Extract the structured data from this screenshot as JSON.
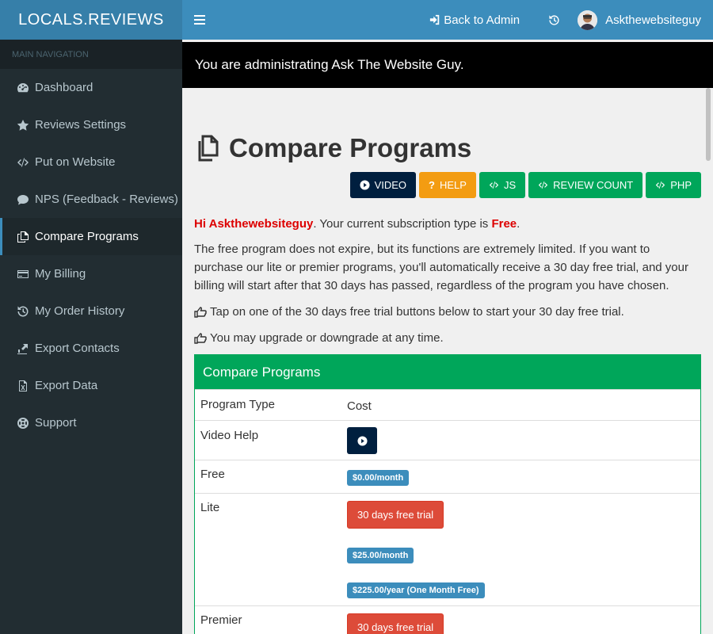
{
  "brand": {
    "logo": "LOCALS.REVIEWS",
    "accent": "#3c8dbc",
    "logo_bg": "#367fa9",
    "sidebar_bg": "#222d32"
  },
  "sidebar": {
    "header": "MAIN NAVIGATION",
    "items": [
      {
        "label": "Dashboard",
        "icon": "dashboard-icon"
      },
      {
        "label": "Reviews Settings",
        "icon": "star-icon"
      },
      {
        "label": "Put on Website",
        "icon": "code-icon"
      },
      {
        "label": "NPS (Feedback - Reviews)",
        "icon": "comment-icon"
      },
      {
        "label": "Compare Programs",
        "icon": "copy-icon",
        "active": true
      },
      {
        "label": "My Billing",
        "icon": "credit-card-icon"
      },
      {
        "label": "My Order History",
        "icon": "history-icon"
      },
      {
        "label": "Export Contacts",
        "icon": "export-icon"
      },
      {
        "label": "Export Data",
        "icon": "file-excel-icon"
      },
      {
        "label": "Support",
        "icon": "life-ring-icon"
      }
    ]
  },
  "header": {
    "back_admin": "Back to Admin",
    "username": "Askthewebsiteguy"
  },
  "notice": "You are administrating Ask The Website Guy.",
  "main": {
    "title": "Compare Programs",
    "buttons": {
      "video": "VIDEO",
      "help": "HELP",
      "js": "JS",
      "review_count": "REVIEW COUNT",
      "php": "PHP"
    },
    "greeting_prefix": "Hi ",
    "greeting_name": "Askthewebsiteguy",
    "greeting_mid": ". Your current subscription type is ",
    "subscription": "Free",
    "greeting_end": ".",
    "description": "The free program does not expire, but its functions are extremely limited. If you want to purchase our lite or premier programs, you'll automatically receive a 30 day free trial, and your billing will start after that 30 days has passed, regardless of the program you have chosen.",
    "tip1": "Tap on one of the 30 days free trial buttons below to start your 30 day free trial.",
    "tip2": "You may upgrade or downgrade at any time."
  },
  "compare": {
    "title": "Compare Programs",
    "col_type": "Program Type",
    "col_cost": "Cost",
    "video_help": "Video Help",
    "free": {
      "name": "Free",
      "price": "$0.00/month"
    },
    "lite": {
      "name": "Lite",
      "trial": "30 days free trial",
      "monthly": "$25.00/month",
      "yearly": "$225.00/year (One Month Free)"
    },
    "premier": {
      "name": "Premier",
      "trial": "30 days free trial"
    }
  }
}
